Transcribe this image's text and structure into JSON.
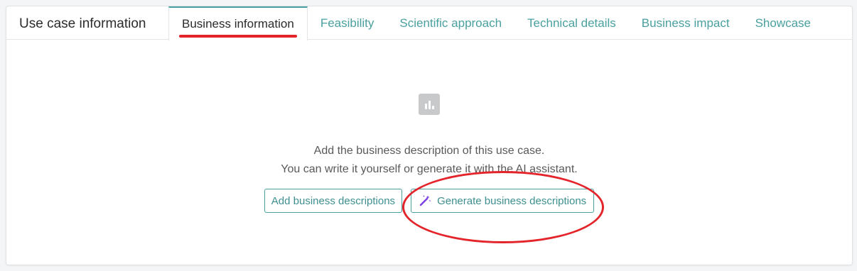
{
  "section_title": "Use case information",
  "tabs": [
    {
      "label": "Business information",
      "active": true
    },
    {
      "label": "Feasibility",
      "active": false
    },
    {
      "label": "Scientific approach",
      "active": false
    },
    {
      "label": "Technical details",
      "active": false
    },
    {
      "label": "Business impact",
      "active": false
    },
    {
      "label": "Showcase",
      "active": false
    }
  ],
  "empty_state": {
    "icon": "bar-chart-icon",
    "line1": "Add the business description of this use case.",
    "line2": "You can write it yourself or generate it with the AI assistant."
  },
  "actions": {
    "add_label": "Add business descriptions",
    "generate_label": "Generate business descriptions",
    "generate_icon": "magic-wand-icon"
  },
  "colors": {
    "accent": "#4a9f9f",
    "annotation": "#e3242b",
    "wand": "#7b3fe4"
  }
}
